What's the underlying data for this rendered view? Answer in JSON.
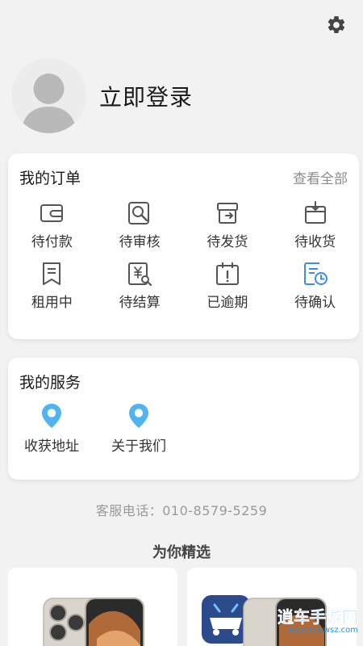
{
  "header": {
    "settings_icon": "gear-icon"
  },
  "profile": {
    "avatar_icon": "default-avatar-icon",
    "login_label": "立即登录"
  },
  "orders": {
    "title": "我的订单",
    "view_all": "查看全部",
    "items": [
      {
        "label": "待付款",
        "icon": "wallet-icon"
      },
      {
        "label": "待审核",
        "icon": "search-document-icon"
      },
      {
        "label": "待发货",
        "icon": "shipping-box-icon"
      },
      {
        "label": "待收货",
        "icon": "receive-box-icon"
      },
      {
        "label": "租用中",
        "icon": "bookmark-doc-icon"
      },
      {
        "label": "待结算",
        "icon": "yuan-search-icon"
      },
      {
        "label": "已逾期",
        "icon": "calendar-alert-icon"
      },
      {
        "label": "待确认",
        "icon": "clock-document-icon"
      }
    ]
  },
  "services": {
    "title": "我的服务",
    "items": [
      {
        "label": "收获地址",
        "icon": "location-pin-icon"
      },
      {
        "label": "关于我们",
        "icon": "location-pin-icon"
      }
    ]
  },
  "contact": {
    "phone_text": "客服电话：010-8579-5259"
  },
  "picks": {
    "title": "为你精选"
  },
  "colors": {
    "accent_blue": "#3a8ee6",
    "pin_blue": "#4fb4f0",
    "background": "#f2f2f2"
  },
  "watermark": {
    "main": "逍车手游网",
    "url": "www.mwwsz.com"
  }
}
